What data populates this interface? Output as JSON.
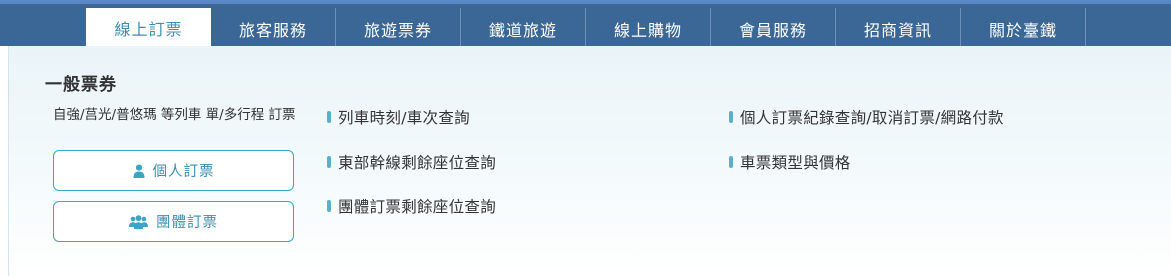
{
  "nav": {
    "items": [
      {
        "label": "線上訂票"
      },
      {
        "label": "旅客服務"
      },
      {
        "label": "旅遊票券"
      },
      {
        "label": "鐵道旅遊"
      },
      {
        "label": "線上購物"
      },
      {
        "label": "會員服務"
      },
      {
        "label": "招商資訊"
      },
      {
        "label": "關於臺鐵"
      }
    ],
    "active_index": 0
  },
  "panel": {
    "section_title": "一般票券",
    "description": "自強/莒光/普悠瑪 等列車 單/多行程 訂票",
    "buttons": {
      "individual": {
        "label": "個人訂票",
        "icon": "person-icon"
      },
      "group": {
        "label": "團體訂票",
        "icon": "group-icon"
      }
    },
    "links_col1": [
      "列車時刻/車次查詢",
      "東部幹線剩餘座位查詢",
      "團體訂票剩餘座位查詢"
    ],
    "links_col2": [
      "個人訂票紀錄查詢/取消訂票/網路付款",
      "車票類型與價格"
    ]
  },
  "colors": {
    "nav_bg": "#3a6795",
    "accent": "#3aa5c4",
    "accent_text": "#3a8fb0"
  }
}
